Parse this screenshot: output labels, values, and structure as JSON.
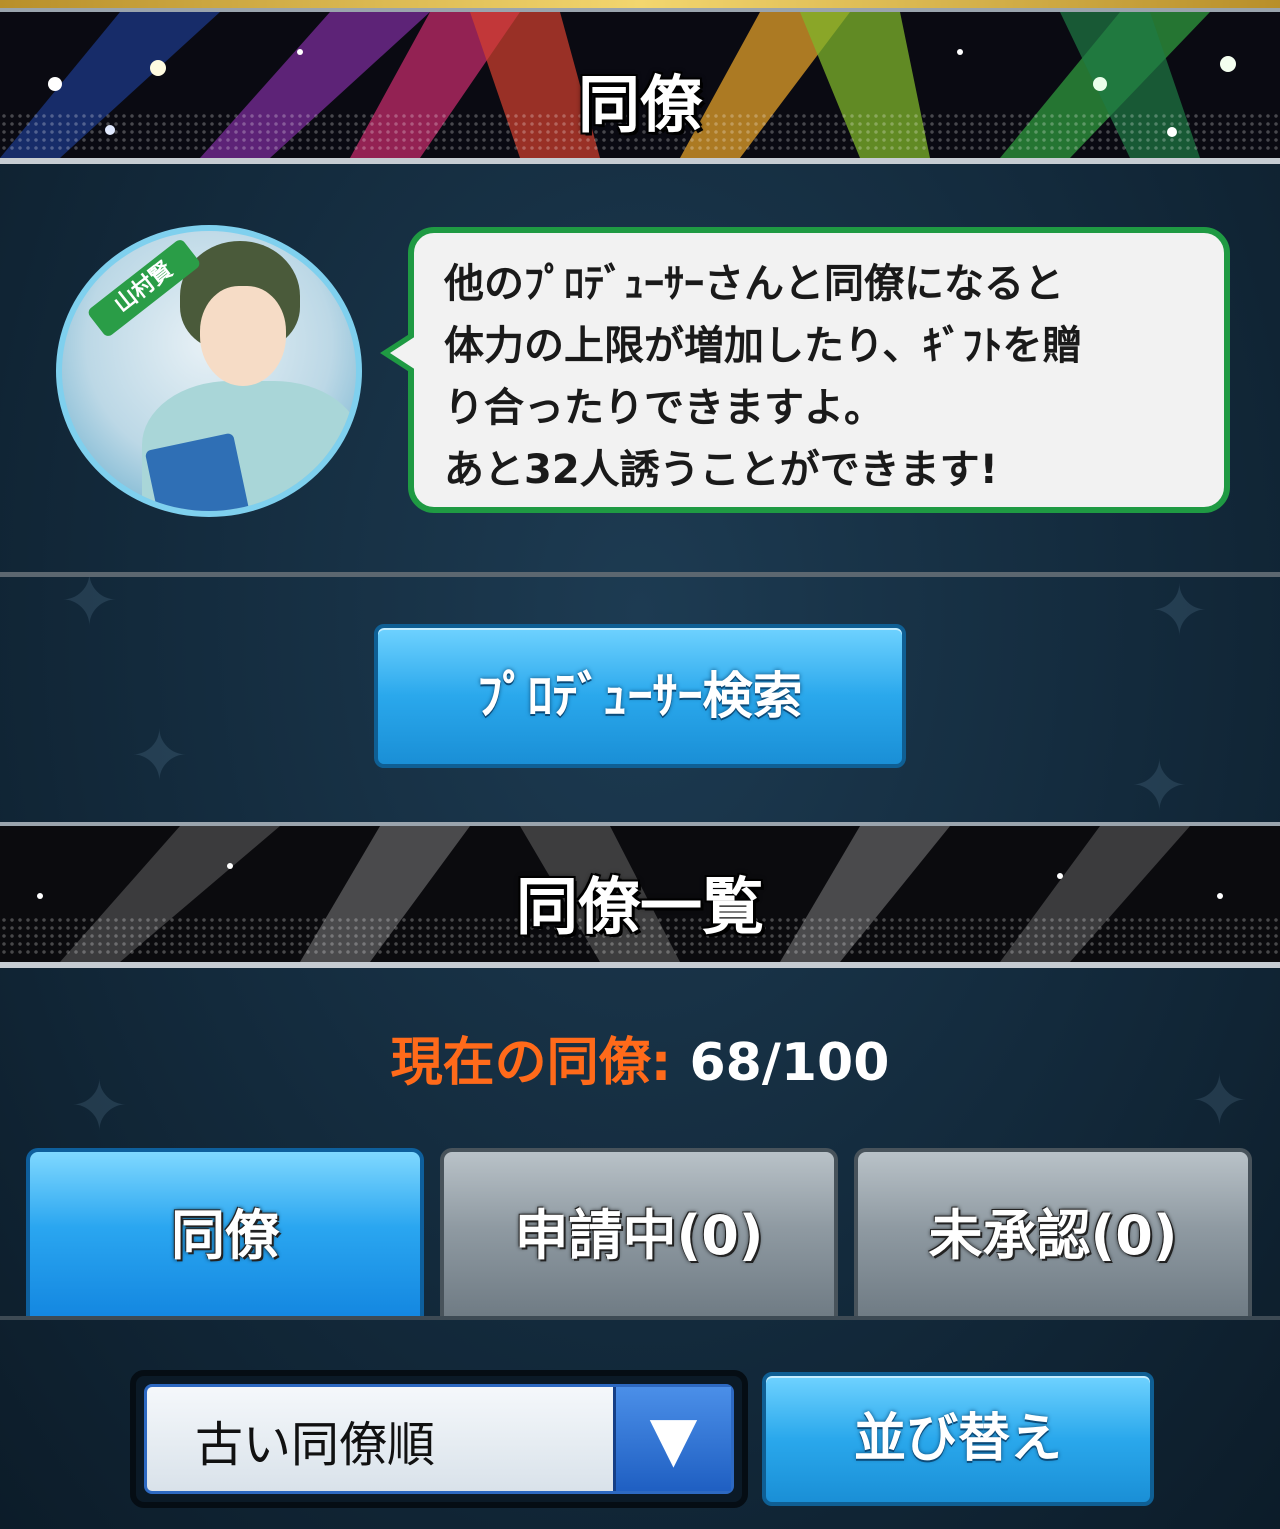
{
  "header": {
    "title": "同僚"
  },
  "intro": {
    "character_name": "山村賢",
    "message_lines": [
      "他のﾌﾟﾛﾃﾞｭｰｻｰさんと同僚になると",
      "体力の上限が増加したり、ｷﾞﾌﾄを贈",
      "り合ったりできますよ。",
      "あと32人誘うことができます!"
    ]
  },
  "search_button": {
    "label": "ﾌﾟﾛﾃﾞｭｰｻｰ検索"
  },
  "list_header": {
    "title": "同僚一覧"
  },
  "count": {
    "label": "現在の同僚:",
    "value": "68/100"
  },
  "tabs": [
    {
      "label": "同僚",
      "active": true
    },
    {
      "label": "申請中(0)",
      "active": false
    },
    {
      "label": "未承認(0)",
      "active": false
    }
  ],
  "sort": {
    "selected": "古い同僚順",
    "button_label": "並び替え",
    "arrow_icon": "triangle-down-icon"
  },
  "colors": {
    "accent_orange": "#ff6a1a",
    "bubble_border": "#1f9a43",
    "button_blue": "#2aa8ec"
  }
}
